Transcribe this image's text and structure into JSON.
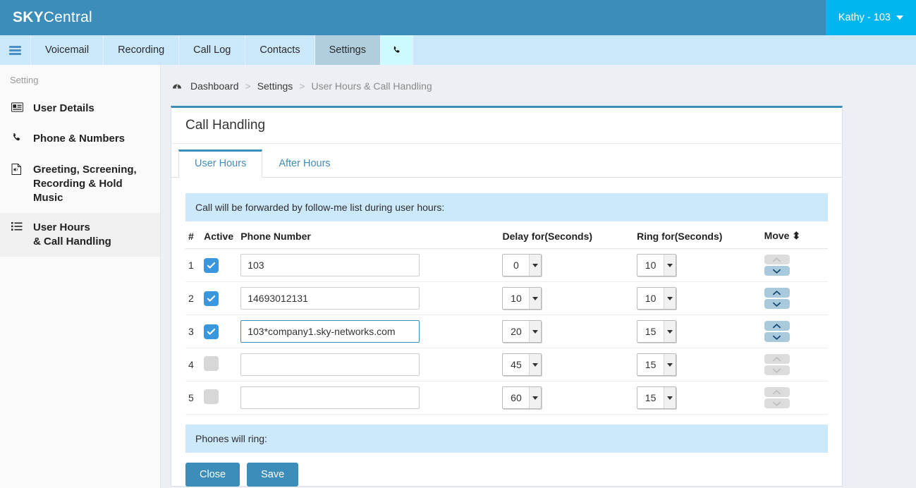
{
  "brand": {
    "bold": "SKY",
    "light": "Central"
  },
  "user": {
    "label": "Kathy - 103",
    "icon": "chevron-down-icon"
  },
  "nav": {
    "menu_icon": "hamburger-icon",
    "items": [
      {
        "label": "Voicemail",
        "active": false
      },
      {
        "label": "Recording",
        "active": false
      },
      {
        "label": "Call Log",
        "active": false
      },
      {
        "label": "Contacts",
        "active": false
      },
      {
        "label": "Settings",
        "active": true
      }
    ],
    "phone_tab": {
      "icon": "phone-icon",
      "label": "✆"
    }
  },
  "sidebar": {
    "caption": "Setting",
    "items": [
      {
        "label": "User Details",
        "label2": "",
        "icon": "id-card-icon",
        "active": false
      },
      {
        "label": "Phone & Numbers",
        "label2": "",
        "icon": "phone-icon",
        "active": false
      },
      {
        "label": "Greeting, Screening,",
        "label2": "Recording & Hold Music",
        "icon": "audio-file-icon",
        "active": false
      },
      {
        "label": "User Hours",
        "label2": "& Call Handling",
        "icon": "list-icon",
        "active": true
      }
    ]
  },
  "breadcrumb": {
    "home_icon": "dashboard-icon",
    "home": "Dashboard",
    "sep": ">",
    "middle": "Settings",
    "current": "User Hours & Call Handling"
  },
  "card": {
    "title": "Call Handling",
    "tabs": [
      {
        "label": "User Hours",
        "active": true
      },
      {
        "label": "After Hours",
        "active": false
      }
    ],
    "banner": "Call will be forwarded by follow-me list during user hours:",
    "footer_banner": "Phones will ring:",
    "buttons": {
      "close": "Close",
      "save": "Save"
    }
  },
  "table": {
    "headers": {
      "num": "#",
      "active": "Active",
      "phone": "Phone Number",
      "delay": "Delay for(Seconds)",
      "ring": "Ring for(Seconds)",
      "move": "Move",
      "move_icon": "sort-icon"
    },
    "rows": [
      {
        "num": "1",
        "active": true,
        "phone": "103",
        "delay": "0",
        "ring": "10",
        "up_enabled": false,
        "down_enabled": true,
        "focused": false
      },
      {
        "num": "2",
        "active": true,
        "phone": "14693012131",
        "delay": "10",
        "ring": "10",
        "up_enabled": true,
        "down_enabled": true,
        "focused": false
      },
      {
        "num": "3",
        "active": true,
        "phone": "103*company1.sky-networks.com",
        "delay": "20",
        "ring": "15",
        "up_enabled": true,
        "down_enabled": true,
        "focused": true
      },
      {
        "num": "4",
        "active": false,
        "phone": "",
        "delay": "45",
        "ring": "15",
        "up_enabled": false,
        "down_enabled": false,
        "focused": false
      },
      {
        "num": "5",
        "active": false,
        "phone": "",
        "delay": "60",
        "ring": "15",
        "up_enabled": false,
        "down_enabled": false,
        "focused": false
      }
    ]
  },
  "colors": {
    "brand_blue": "#3d8dba",
    "user_cyan": "#00b6ee",
    "nav_blue": "#cbe7fa",
    "banner_blue": "#cce8fb",
    "checkbox_on": "#3a97dd",
    "page_bg": "#eceff3"
  }
}
